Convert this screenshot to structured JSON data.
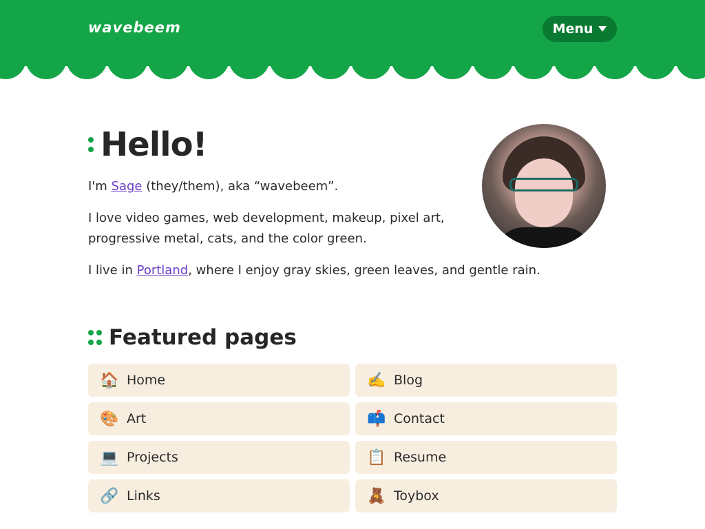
{
  "header": {
    "logo_text": "wavebeem",
    "menu_label": "Menu",
    "colors": {
      "green": "#13a547",
      "menu_bg": "#0a7a32"
    }
  },
  "intro": {
    "heading": "Hello!",
    "line1_prefix": "I'm ",
    "line1_link": "Sage",
    "line1_suffix": " (they/them), aka “wavebeem”.",
    "line2": "I love video games, web development, makeup, pixel art,",
    "line3": "progressive metal, cats, and the color green.",
    "line4_prefix": "I live in ",
    "line4_link": "Portland",
    "line4_suffix": ", where I enjoy gray skies, green leaves, and gentle rain."
  },
  "featured": {
    "heading": "Featured pages",
    "items": [
      {
        "icon": "house-icon",
        "glyph": "🏠",
        "label": "Home"
      },
      {
        "icon": "writing-hand-icon",
        "glyph": "✍️",
        "label": "Blog"
      },
      {
        "icon": "palette-icon",
        "glyph": "🎨",
        "label": "Art"
      },
      {
        "icon": "mailbox-icon",
        "glyph": "📫",
        "label": "Contact"
      },
      {
        "icon": "laptop-icon",
        "glyph": "💻",
        "label": "Projects"
      },
      {
        "icon": "clipboard-icon",
        "glyph": "📋",
        "label": "Resume"
      },
      {
        "icon": "link-icon",
        "glyph": "🔗",
        "label": "Links"
      },
      {
        "icon": "teddy-bear-icon",
        "glyph": "🧸",
        "label": "Toybox"
      }
    ]
  },
  "colors": {
    "link": "#6a3fc6",
    "card_bg": "#f8eee0",
    "heading": "#262626"
  }
}
